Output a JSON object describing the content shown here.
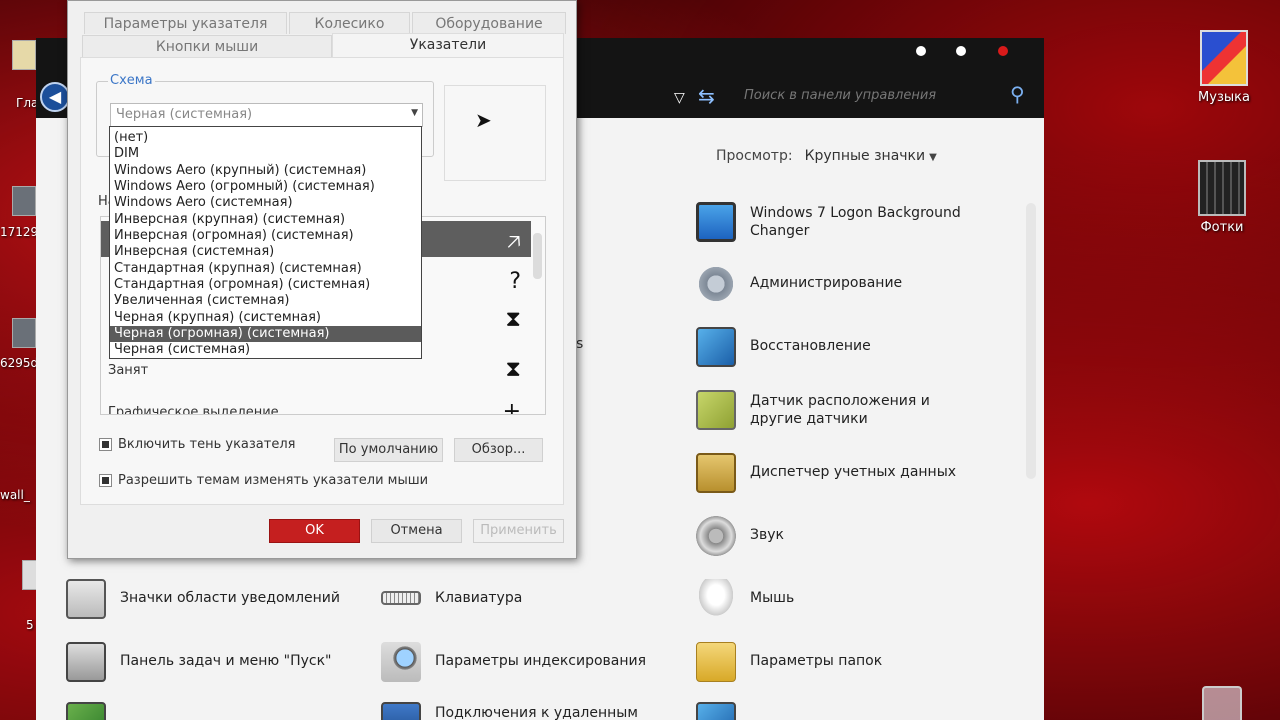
{
  "desktop": {
    "music_label": "Музыка",
    "photos_label": "Фотки",
    "left_labels": [
      "Гла",
      "17129",
      "6295d",
      "wall_",
      "5"
    ]
  },
  "cp_window": {
    "search_placeholder": "Поиск в панели управления",
    "view_label": "Просмотр:",
    "view_value": "Крупные значки",
    "partial_text": "s",
    "items": [
      {
        "label": "Windows 7 Logon Background Changer",
        "icon": "monitor-icon"
      },
      {
        "label": "Администрирование",
        "icon": "gear-icon"
      },
      {
        "label": "Восстановление",
        "icon": "restore-icon"
      },
      {
        "label": "Датчик расположения и другие датчики",
        "icon": "sensor-icon"
      },
      {
        "label": "Диспетчер учетных данных",
        "icon": "safe-icon"
      },
      {
        "label": "Звук",
        "icon": "speaker-icon"
      },
      {
        "label": "Значки области уведомлений",
        "icon": "notification-icon"
      },
      {
        "label": "Клавиатура",
        "icon": "keyboard-icon"
      },
      {
        "label": "Мышь",
        "icon": "mouse-icon"
      },
      {
        "label": "Панель задач и меню \"Пуск\"",
        "icon": "taskbar-icon"
      },
      {
        "label": "Параметры индексирования",
        "icon": "indexing-icon"
      },
      {
        "label": "Параметры папок",
        "icon": "folder-icon"
      },
      {
        "label": "Подключения к удаленным",
        "icon": "remote-icon"
      }
    ]
  },
  "dialog": {
    "tabs": {
      "pointer_params": "Параметры указателя",
      "wheel": "Колесико",
      "hardware": "Оборудование",
      "buttons": "Кнопки мыши",
      "pointers": "Указатели"
    },
    "scheme_title": "Схема",
    "scheme_value": "Черная (системная)",
    "partial_na": "На",
    "cursor_rows": [
      {
        "name": "",
        "glyph": "🡥",
        "selected": true
      },
      {
        "name": "",
        "glyph": "?",
        "selected": false
      },
      {
        "name": "",
        "glyph": "⧗",
        "selected": false
      },
      {
        "name": "Занят",
        "glyph": "⧗",
        "selected": false
      },
      {
        "name": "Графическое выделение",
        "glyph": "+",
        "selected": false
      }
    ],
    "shadow_label": "Включить тень указателя",
    "themes_label": "Разрешить темам изменять указатели мыши",
    "default_btn": "По умолчанию",
    "browse_btn": "Обзор...",
    "ok_btn": "OK",
    "cancel_btn": "Отмена",
    "apply_btn": "Применить"
  },
  "dropdown_options": [
    "(нет)",
    "DIM",
    "Windows Aero (крупный) (системная)",
    "Windows Aero (огромный) (системная)",
    "Windows Aero (системная)",
    "Инверсная (крупная) (системная)",
    "Инверсная (огромная) (системная)",
    "Инверсная (системная)",
    "Стандартная (крупная) (системная)",
    "Стандартная (огромная) (системная)",
    "Увеличенная (системная)",
    "Черная (крупная) (системная)",
    "Черная (огромная) (системная)",
    "Черная (системная)"
  ],
  "dropdown_selected_index": 12,
  "colors": {
    "accent_blue": "#3b76c7",
    "ok_red": "#c51f1f",
    "selection_gray": "#5b5b5b"
  }
}
